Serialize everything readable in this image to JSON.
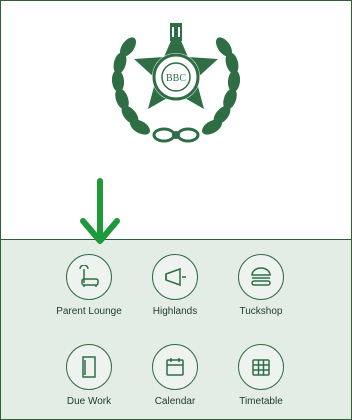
{
  "logo": {
    "monogram": "BBC"
  },
  "menu": {
    "items": [
      {
        "label": "Parent Lounge",
        "icon": "sofa-lamp-icon"
      },
      {
        "label": "Highlands",
        "icon": "megaphone-icon"
      },
      {
        "label": "Tuckshop",
        "icon": "burger-icon"
      },
      {
        "label": "Due Work",
        "icon": "document-icon"
      },
      {
        "label": "Calendar",
        "icon": "calendar-icon"
      },
      {
        "label": "Timetable",
        "icon": "timetable-grid-icon"
      }
    ]
  },
  "colors": {
    "brand_green": "#2f6e45",
    "panel_bg": "#e4ece6",
    "arrow_green": "#1f9a3a"
  }
}
